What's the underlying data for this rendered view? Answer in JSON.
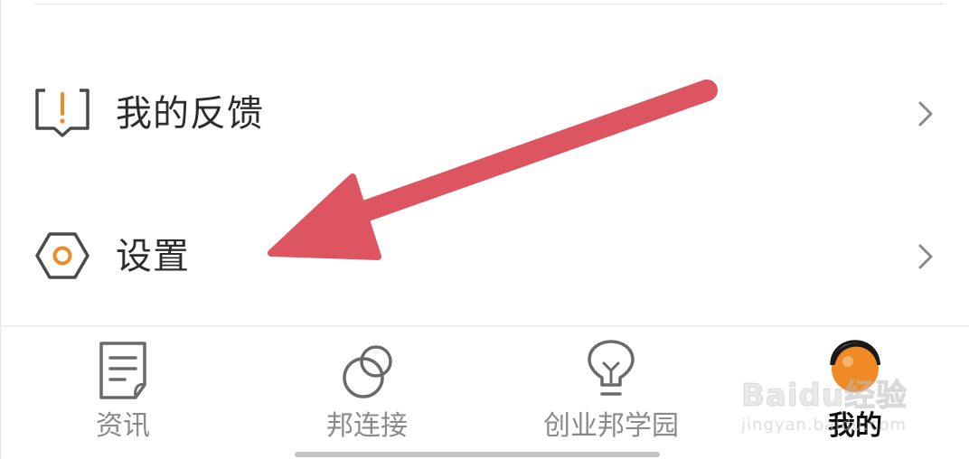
{
  "menu": {
    "items": [
      {
        "label": "我的反馈",
        "icon": "feedback-icon"
      },
      {
        "label": "设置",
        "icon": "settings-icon"
      }
    ]
  },
  "tabbar": {
    "tabs": [
      {
        "label": "资讯",
        "icon": "news-document-icon"
      },
      {
        "label": "邦连接",
        "icon": "linked-circles-icon"
      },
      {
        "label": "创业邦学园",
        "icon": "lightbulb-icon"
      },
      {
        "label": "我的",
        "icon": "profile-avatar-icon",
        "selected": true
      }
    ]
  },
  "watermark": {
    "brand": "Baidu经验",
    "url": "jingyan.baidu.com"
  },
  "colors": {
    "accent_orange": "#f08a24",
    "annotation_arrow": "#dc5560",
    "icon_gray": "#5a5a5a",
    "label_gray": "#8a8a8a"
  }
}
